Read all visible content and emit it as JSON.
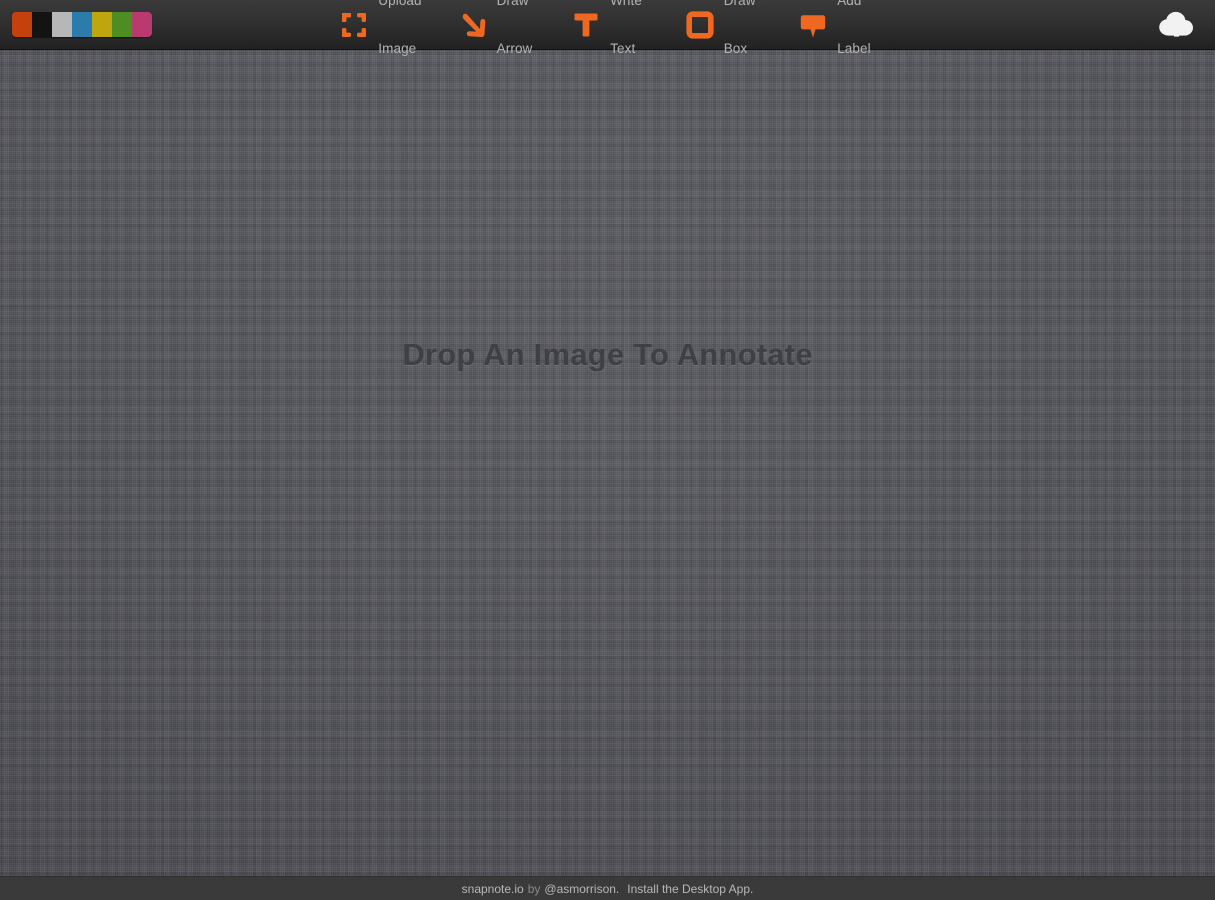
{
  "app": {
    "title": "snapnote.io",
    "accent_color": "#ef6822"
  },
  "palette": {
    "name": "color-palette",
    "swatches": [
      {
        "name": "orange",
        "color": "#c4410d"
      },
      {
        "name": "black",
        "color": "#131313"
      },
      {
        "name": "lightgray",
        "color": "#b7b7b7"
      },
      {
        "name": "blue",
        "color": "#2b7cab"
      },
      {
        "name": "gold",
        "color": "#bfa60f"
      },
      {
        "name": "green",
        "color": "#4e8c24"
      },
      {
        "name": "magenta",
        "color": "#b83a6e"
      }
    ]
  },
  "toolbar": {
    "tools": [
      {
        "icon": "upload-image-icon",
        "line1": "Upload",
        "line2": "Image"
      },
      {
        "icon": "draw-arrow-icon",
        "line1": "Draw",
        "line2": "Arrow"
      },
      {
        "icon": "write-text-icon",
        "line1": "Write",
        "line2": "Text"
      },
      {
        "icon": "draw-box-icon",
        "line1": "Draw",
        "line2": "Box"
      },
      {
        "icon": "add-label-icon",
        "line1": "Add",
        "line2": "Label"
      }
    ],
    "cloud_upload": {
      "icon": "cloud-upload-icon",
      "color": "#f0f0f0"
    }
  },
  "canvas": {
    "drop_message": "Drop An Image To Annotate",
    "background_color": "#56565e"
  },
  "footer": {
    "site_link": "snapnote.io",
    "by_text": "by",
    "author_link": "@asmorrison.",
    "install_link": "Install the Desktop App."
  }
}
